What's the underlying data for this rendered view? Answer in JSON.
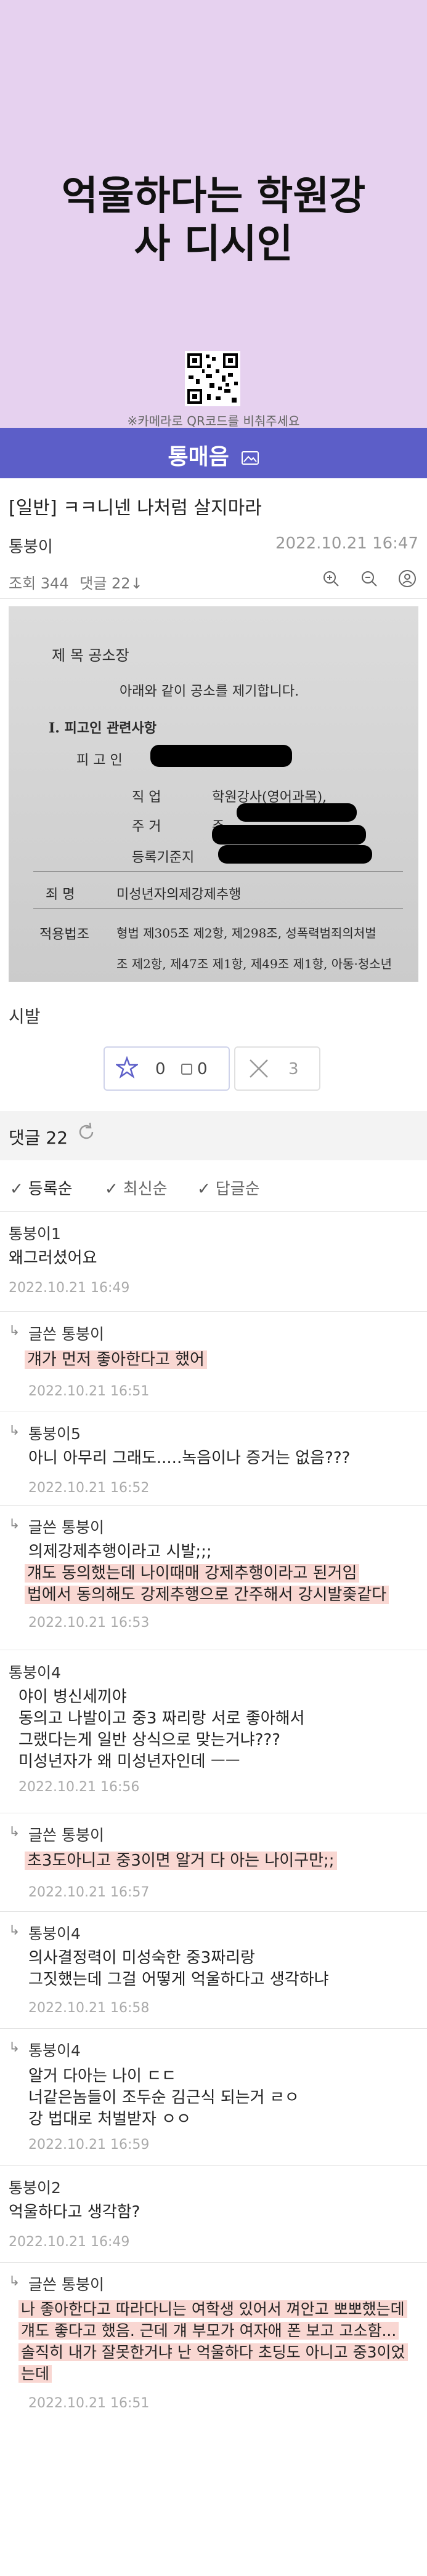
{
  "banner": {
    "title_line1": "억울하다는 학원강",
    "title_line2": "사 디시인",
    "qr_caption": "※카메라로 QR코드를 비춰주세요",
    "bg_color": "#e6d1ef"
  },
  "site": {
    "title": "통매음",
    "icon": "image-icon",
    "color": "#5c5ec8"
  },
  "post": {
    "title": "[일반] ㅋㅋ니넨 나처럼 살지마라",
    "author": "통붕이",
    "date": "2022.10.21 16:47",
    "views": "조회 344",
    "comments_count": "댓글 22↓",
    "body": "시발",
    "upvotes": "0",
    "upvotes_fixed": "0",
    "downvotes": "3"
  },
  "document_photo": {
    "heading": "제  목          공소장",
    "subheading": "아래와 같이 공소를 제기합니다.",
    "section": "I. 피고인 관련사항",
    "defendant_label": "피 고 인",
    "job_label": "직    업",
    "job_value": "학원강사(영어과목),",
    "address_label": "주    거",
    "address_value": "주",
    "registry_label": "등록기준지",
    "charge_label": "죄    명",
    "charge_value": "미성년자의제강제추행",
    "law_label": "적용법조",
    "law_value1": "형법 제305조 제2항, 제298조, 성폭력범죄의처벌",
    "law_value2": "조 제2항, 제47조 제1항, 제49조 제1항, 아동·청소년"
  },
  "comments_section": {
    "label": "댓글 22"
  },
  "sort": {
    "opt1": "등록순",
    "opt2": "최신순",
    "opt3": "답글순"
  },
  "comments": [
    {
      "name": "통붕이1",
      "lines": [
        "왜그러셨어요"
      ],
      "date": "2022.10.21 16:49"
    },
    {
      "name": "글쓴 통붕이",
      "lines": [
        "걔가 먼저 좋아한다고 했어"
      ],
      "date": "2022.10.21 16:51"
    },
    {
      "name": "통붕이5",
      "lines": [
        "아니 아무리 그래도.....녹음이나 증거는 없음???"
      ],
      "date": "2022.10.21 16:52"
    },
    {
      "name": "글쓴 통붕이",
      "lines": [
        "의제강제추행이라고 시발;;;",
        "걔도 동의했는데 나이때매 강제추행이라고 된거임",
        "법에서 동의해도 강제추행으로 간주해서 강시발좆같다"
      ],
      "date": "2022.10.21 16:53"
    },
    {
      "name": "통붕이4",
      "lines": [
        "야이 병신세끼야",
        "동의고 나발이고 중3 짜리랑 서로 좋아해서",
        "그랬다는게 일반 상식으로 맞는거냐???",
        "미성년자가 왜 미성년자인데 ㅡㅡ"
      ],
      "date": "2022.10.21 16:56"
    },
    {
      "name": "글쓴 통붕이",
      "lines": [
        "초3도아니고 중3이면 알거 다 아는 나이구만;;"
      ],
      "date": "2022.10.21 16:57"
    },
    {
      "name": "통붕이4",
      "lines": [
        "의사결정력이 미성숙한 중3짜리랑",
        "그짓했는데 그걸 어떻게 억울하다고 생각하냐"
      ],
      "date": "2022.10.21 16:58"
    },
    {
      "name": "통붕이4",
      "lines": [
        "알거 다아는 나이 ㄷㄷ",
        "너같은놈들이 조두순 김근식 되는거 ㄹㅇ",
        "강 법대로 처벌받자 ㅇㅇ"
      ],
      "date": "2022.10.21 16:59"
    },
    {
      "name": "통붕이2",
      "lines": [
        "억울하다고 생각함?"
      ],
      "date": "2022.10.21 16:49"
    },
    {
      "name": "글쓴 통붕이",
      "lines": [
        "나 좋아한다고 따라다니는 여학생 있어서 껴안고 뽀뽀했는데",
        "걔도 좋다고 했음. 근데 걔 부모가 여자애 폰 보고 고소함...",
        "솔직히 내가 잘못한거냐 난 억울하다 초딩도 아니고 중3이었",
        "는데"
      ],
      "date": "2022.10.21 16:51"
    }
  ]
}
